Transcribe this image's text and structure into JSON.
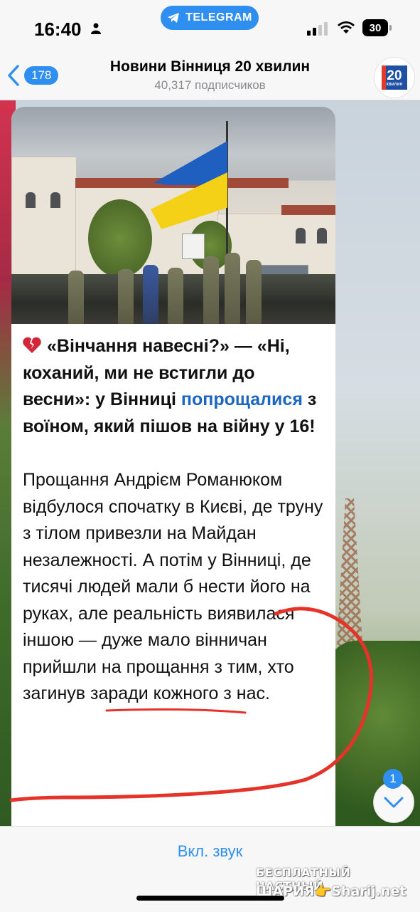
{
  "status_bar": {
    "time": "16:40",
    "app_pill": "TELEGRAM",
    "battery": "30"
  },
  "header": {
    "back_count": "178",
    "channel_title": "Новини Вінниця 20 хвилин",
    "subscribers": "40,317 подписчиков",
    "avatar_text": "20",
    "avatar_subtext": "ХВИЛИН"
  },
  "message": {
    "title_part1": "«Вінчання навесні?» — «Ні, коханий, ми не встигли до весни»: у Вінниці ",
    "title_link": "попрощалися",
    "title_part2": " з воїном, який пішов на війну у 16!",
    "body": "Прощання Андрієм Романюком відбулося спочатку в Києві, де труну з тілом привезли на Майдан незалежності. А потім у Вінниці, де тисячі людей мали б нести його на руках, але реальність виявилася іншою — дуже мало вінничан прийшли на прощання з тим, хто загинув заради кожного з нас."
  },
  "scroll_badge": "1",
  "bottom": {
    "sound_button": "Вкл. звук"
  },
  "watermark": {
    "line1": "БЕСПЛАТНЫЙ ЧАСТНЫЙ",
    "line2": "ШАРИЯ👉Sharij.net"
  },
  "colors": {
    "accent": "#2f8ff0",
    "link": "#1a66c2",
    "marker": "#e5332a"
  }
}
